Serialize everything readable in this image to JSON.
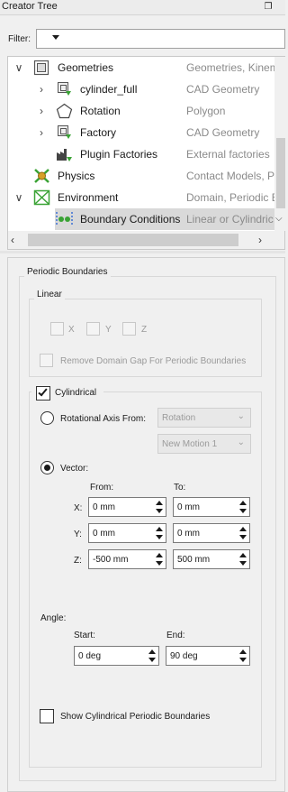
{
  "title": "Creator Tree",
  "filter": {
    "label": "Filter:",
    "value": ""
  },
  "tree": [
    {
      "label": "Geometries",
      "desc": "Geometries, Kinem",
      "expander": "expanded",
      "icon": "geometries-icon"
    },
    {
      "label": "cylinder_full",
      "desc": "CAD Geometry",
      "expander": "collapsed",
      "icon": "cad-geometry-icon"
    },
    {
      "label": "Rotation",
      "desc": "Polygon",
      "expander": "collapsed",
      "icon": "polygon-icon"
    },
    {
      "label": "Factory",
      "desc": "CAD Geometry",
      "expander": "collapsed",
      "icon": "cad-geometry-icon"
    },
    {
      "label": "Plugin Factories",
      "desc": "External factories",
      "expander": "none",
      "icon": "factory-icon"
    },
    {
      "label": "Physics",
      "desc": "Contact Models, P",
      "expander": "none",
      "icon": "physics-icon"
    },
    {
      "label": "Environment",
      "desc": "Domain, Periodic B",
      "expander": "expanded",
      "icon": "environment-icon"
    },
    {
      "label": "Boundary Conditions",
      "desc": "Linear or Cylindric",
      "expander": "none",
      "icon": "boundary-conditions-icon",
      "selected": true
    }
  ],
  "periodic": {
    "title": "Periodic Boundaries",
    "linear": {
      "title": "Linear",
      "x": "X",
      "y": "Y",
      "z": "Z",
      "gap_label": "Remove Domain Gap For Periodic Boundaries"
    },
    "cylindrical": {
      "label": "Cylindrical",
      "checked": true,
      "axis_from_label": "Rotational Axis From:",
      "axis_from_value": "Rotation",
      "motion_value": "New Motion 1",
      "vector_label": "Vector:",
      "from_label": "From:",
      "to_label": "To:",
      "rows": [
        {
          "axis": "X:",
          "from": "0 mm",
          "to": "0 mm"
        },
        {
          "axis": "Y:",
          "from": "0 mm",
          "to": "0 mm"
        },
        {
          "axis": "Z:",
          "from": "-500 mm",
          "to": "500 mm"
        }
      ],
      "angle_label": "Angle:",
      "start_label": "Start:",
      "end_label": "End:",
      "start_value": "0 deg",
      "end_value": "90 deg",
      "show_label": "Show Cylindrical Periodic Boundaries"
    }
  }
}
